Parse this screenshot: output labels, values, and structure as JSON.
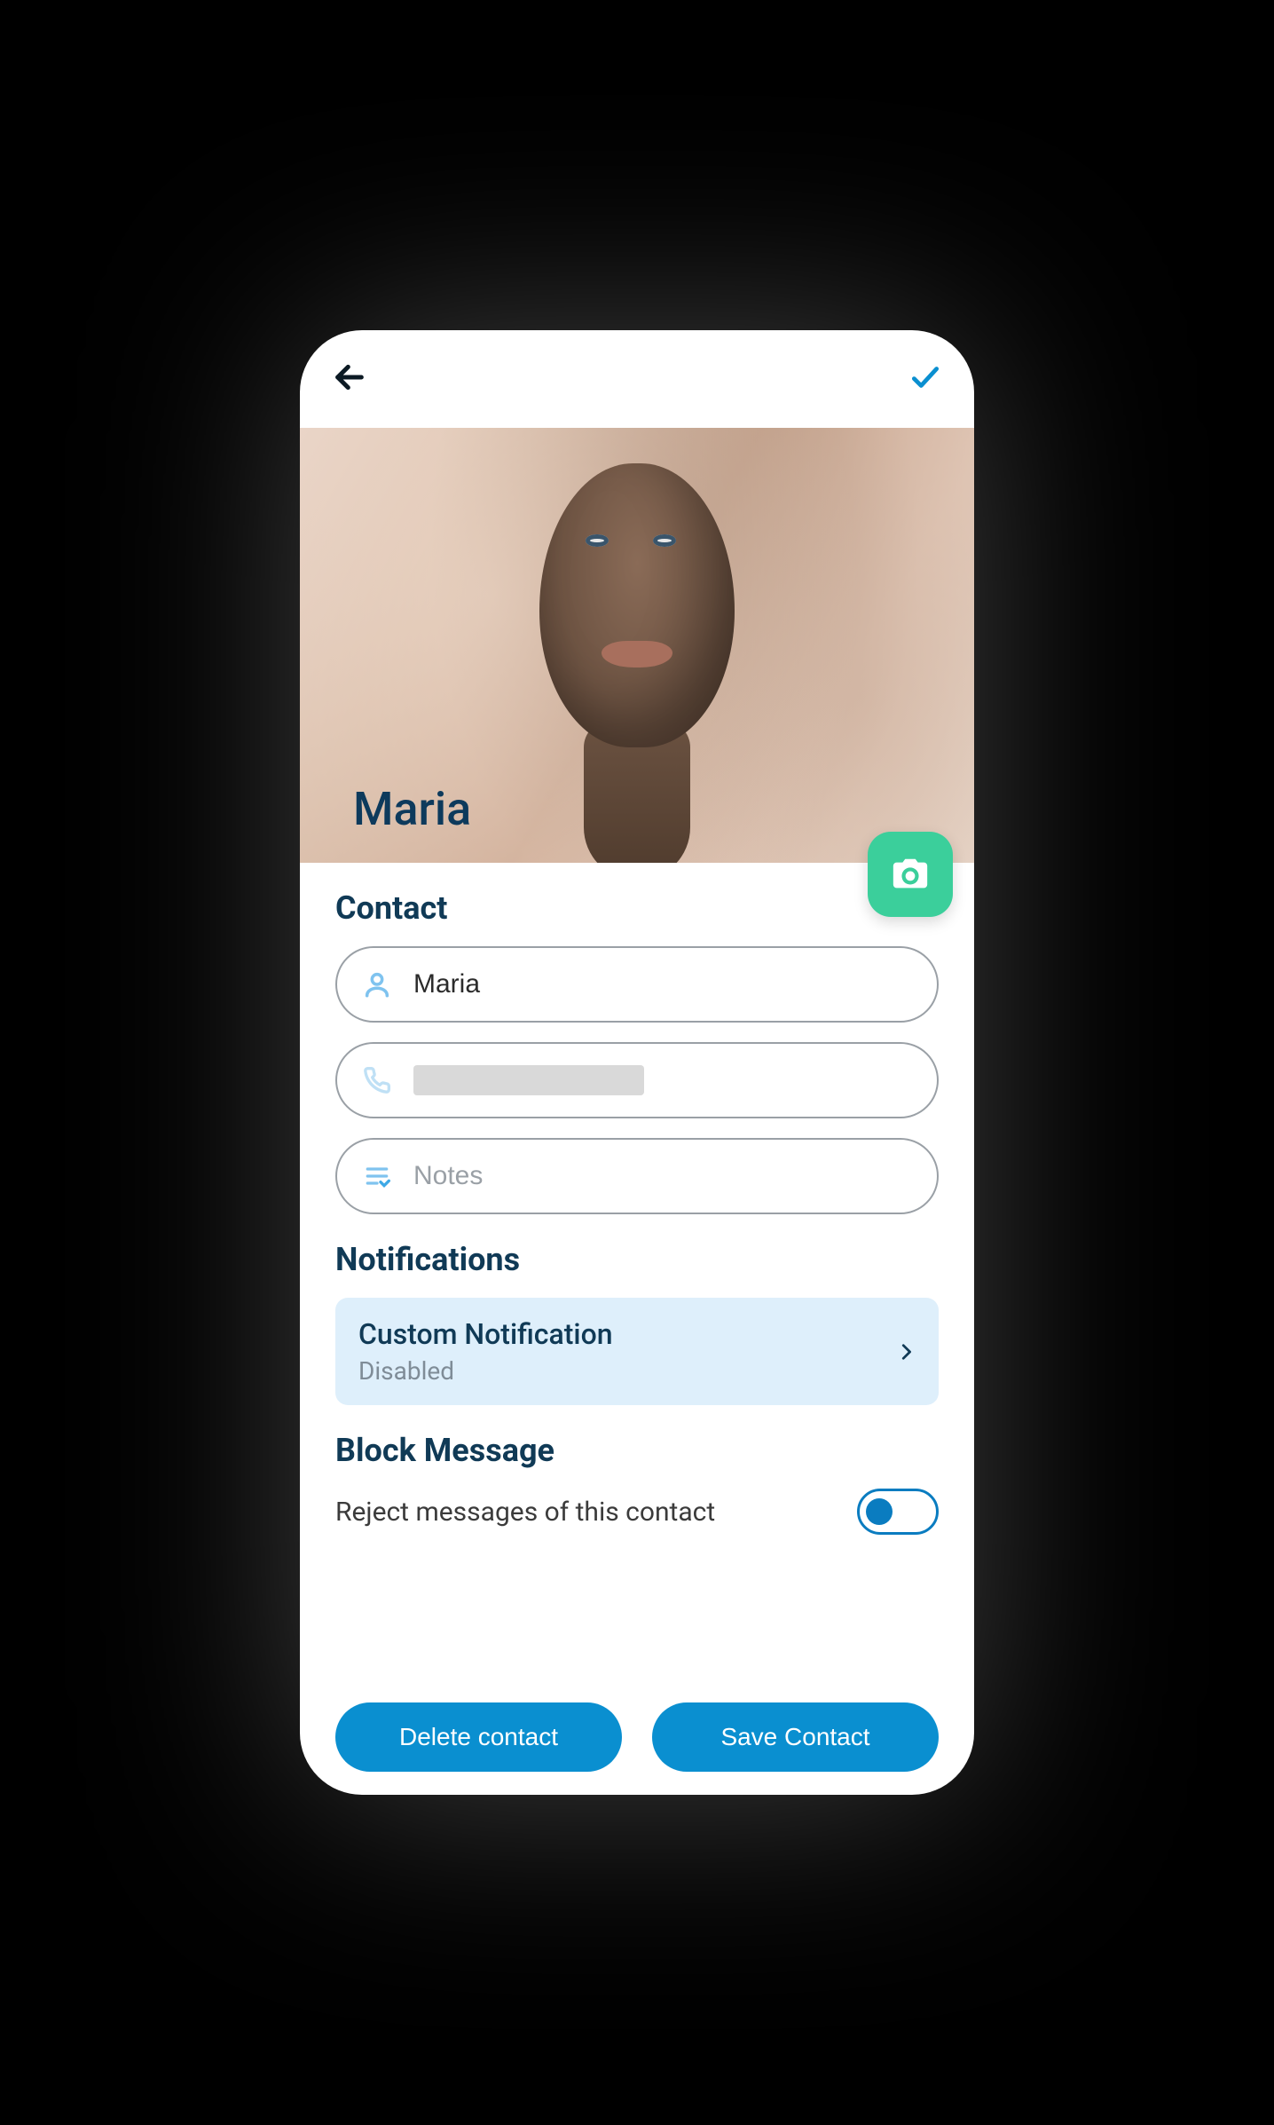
{
  "hero": {
    "name": "Maria"
  },
  "sections": {
    "contact": {
      "title": "Contact",
      "name_value": "Maria",
      "phone_value": "",
      "notes_placeholder": "Notes"
    },
    "notifications": {
      "title": "Notifications",
      "card_title": "Custom Notification",
      "card_status": "Disabled"
    },
    "block": {
      "title": "Block Message",
      "label": "Reject messages of this contact",
      "toggle_on": false
    }
  },
  "footer": {
    "delete_label": "Delete contact",
    "save_label": "Save Contact"
  }
}
